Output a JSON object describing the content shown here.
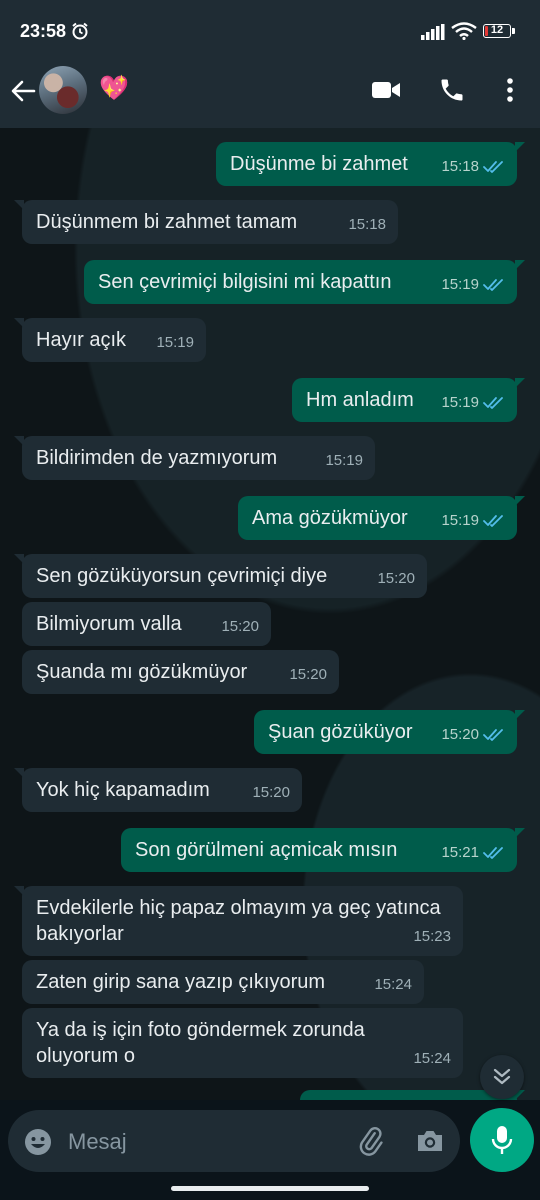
{
  "status_bar": {
    "time": "23:58",
    "battery_level": "12",
    "battery_fraction": 0.12,
    "battery_color": "#e53935",
    "icons": [
      "alarm-icon",
      "signal-icon",
      "wifi-icon",
      "battery-icon"
    ]
  },
  "header": {
    "contact_emoji": "💖",
    "icons": [
      "back-arrow-icon",
      "video-call-icon",
      "voice-call-icon",
      "more-options-icon"
    ]
  },
  "messages": [
    {
      "direction": "out",
      "text": "Düşünme bi zahmet",
      "time": "15:18",
      "status": "read",
      "tail": true
    },
    {
      "direction": "in",
      "text": "Düşünmem bi zahmet tamam",
      "time": "15:18",
      "tail": true
    },
    {
      "direction": "out",
      "text": "Sen çevrimiçi bilgisini mi kapattın",
      "time": "15:19",
      "status": "read",
      "tail": true
    },
    {
      "direction": "in",
      "text": "Hayır açık",
      "time": "15:19",
      "tail": true
    },
    {
      "direction": "out",
      "text": "Hm anladım",
      "time": "15:19",
      "status": "read",
      "tail": true
    },
    {
      "direction": "in",
      "text": "Bildirimden de yazmıyorum",
      "time": "15:19",
      "tail": true
    },
    {
      "direction": "out",
      "text": "Ama gözükmüyor",
      "time": "15:19",
      "status": "read",
      "tail": true
    },
    {
      "direction": "in",
      "text": "Sen gözüküyorsun çevrimiçi diye",
      "time": "15:20",
      "tail": true
    },
    {
      "direction": "in",
      "text": "Bilmiyorum valla",
      "time": "15:20",
      "tail": false
    },
    {
      "direction": "in",
      "text": "Şuanda mı gözükmüyor",
      "time": "15:20",
      "tail": false
    },
    {
      "direction": "out",
      "text": "Şuan gözüküyor",
      "time": "15:20",
      "status": "read",
      "tail": true
    },
    {
      "direction": "in",
      "text": "Yok hiç kapamadım",
      "time": "15:20",
      "tail": true
    },
    {
      "direction": "out",
      "text": "Son görülmeni açmicak mısın",
      "time": "15:21",
      "status": "read",
      "tail": true
    },
    {
      "direction": "in",
      "text": "Evdekilerle hiç papaz olmayım ya geç yatınca bakıyorlar",
      "time": "15:23",
      "tail": true
    },
    {
      "direction": "in",
      "text": "Zaten girip sana yazıp çıkıyorum",
      "time": "15:24",
      "tail": false
    },
    {
      "direction": "in",
      "text": "Ya da iş için foto göndermek zorunda oluyorum o",
      "time": "15:24",
      "tail": false
    },
    {
      "direction": "out",
      "text": "",
      "time": "",
      "status": "partial",
      "tail": true
    }
  ],
  "composer": {
    "placeholder": "Mesaj",
    "icons": [
      "emoji-icon",
      "attach-icon",
      "camera-icon",
      "mic-icon"
    ]
  },
  "colors": {
    "background": "#0b141a",
    "bar": "#1f2c34",
    "incoming_bubble": "#1f2c34",
    "outgoing_bubble": "#005c4b",
    "accent": "#00a884",
    "read_ticks": "#53bdeb"
  }
}
